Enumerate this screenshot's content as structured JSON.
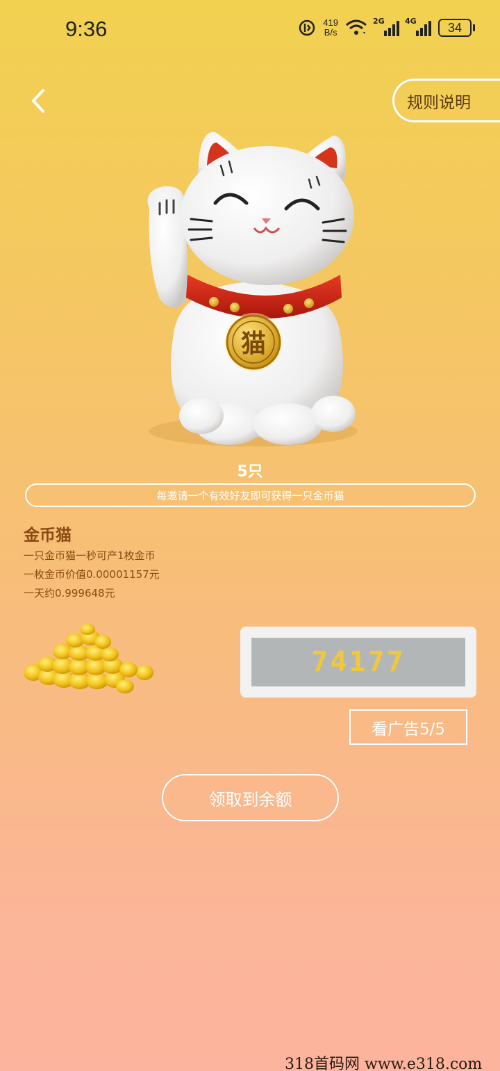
{
  "status_bar": {
    "time": "9:36",
    "net_speed_value": "419",
    "net_speed_unit": "B/s",
    "signal1_label": "2G",
    "signal2_label": "4G",
    "battery": "34"
  },
  "header": {
    "rules_label": "规则说明"
  },
  "cat": {
    "count_text": "5只",
    "medal_char": "猫"
  },
  "invite_text": "每邀请一个有效好友即可获得一只金币猫",
  "info": {
    "title": "金币猫",
    "lines": [
      "一只金币猫一秒可产1枚金币",
      "一枚金币价值0.00001157元",
      "一天约0.999648元"
    ]
  },
  "counter": {
    "value": "74177"
  },
  "ad_button": {
    "label": "看广告5/5"
  },
  "claim_button": {
    "label": "领取到余额"
  },
  "watermark": "318首码网  www.e318.com",
  "colors": {
    "accent_text": "#8a4a12",
    "counter_digits": "#f3c73a",
    "collar": "#d42a1a",
    "coin": "#f2c21a"
  }
}
